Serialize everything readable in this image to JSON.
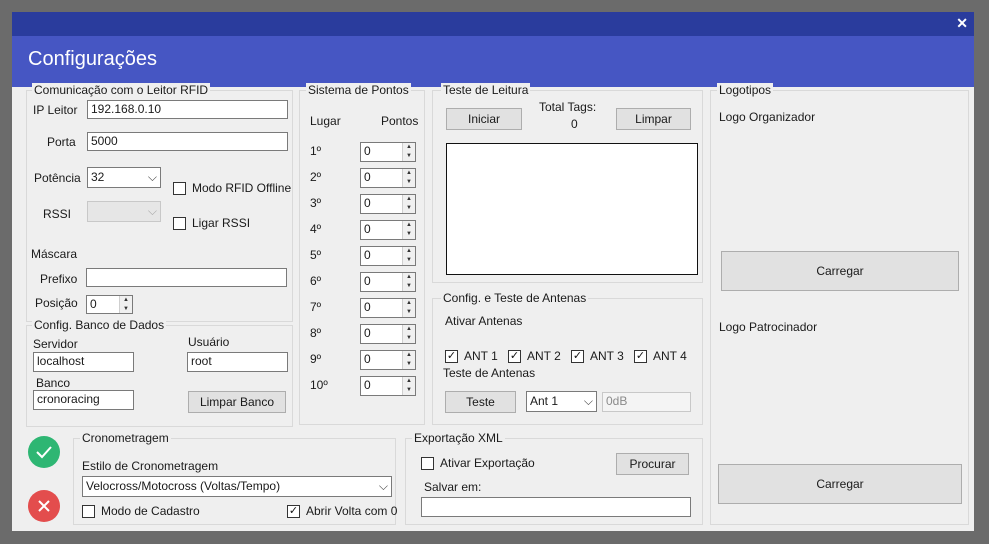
{
  "window": {
    "title": "Configurações",
    "close_glyph": "✕"
  },
  "rfid": {
    "group": "Comunicação com o Leitor RFID",
    "ip_label": "IP Leitor",
    "ip_value": "192.168.0.10",
    "port_label": "Porta",
    "port_value": "5000",
    "power_label": "Potência",
    "power_value": "32",
    "offline_label": "Modo RFID Offline",
    "offline_checked": false,
    "rssi_label": "RSSI",
    "rssi_value": "",
    "rssi_toggle_label": "Ligar RSSI",
    "rssi_toggle_checked": false,
    "mask_label": "Máscara",
    "prefix_label": "Prefixo",
    "prefix_value": "",
    "position_label": "Posição",
    "position_value": "0"
  },
  "db": {
    "group": "Config. Banco de Dados",
    "server_label": "Servidor",
    "server_value": "localhost",
    "user_label": "Usuário",
    "user_value": "root",
    "bank_label": "Banco",
    "bank_value": "cronoracing",
    "clear_button": "Limpar Banco"
  },
  "points": {
    "group": "Sistema de Pontos",
    "place_header": "Lugar",
    "points_header": "Pontos",
    "rows": [
      {
        "place": "1º",
        "value": "0"
      },
      {
        "place": "2º",
        "value": "0"
      },
      {
        "place": "3º",
        "value": "0"
      },
      {
        "place": "4º",
        "value": "0"
      },
      {
        "place": "5º",
        "value": "0"
      },
      {
        "place": "6º",
        "value": "0"
      },
      {
        "place": "7º",
        "value": "0"
      },
      {
        "place": "8º",
        "value": "0"
      },
      {
        "place": "9º",
        "value": "0"
      },
      {
        "place": "10º",
        "value": "0"
      }
    ]
  },
  "read_test": {
    "group": "Teste de Leitura",
    "start_button": "Iniciar",
    "total_label": "Total Tags:",
    "total_value": "0",
    "clear_button": "Limpar"
  },
  "antennas": {
    "group": "Config. e Teste de Antenas",
    "enable_label": "Ativar Antenas",
    "items": [
      {
        "label": "ANT 1",
        "checked": true
      },
      {
        "label": "ANT 2",
        "checked": true
      },
      {
        "label": "ANT 3",
        "checked": true
      },
      {
        "label": "ANT 4",
        "checked": true
      }
    ],
    "test_label": "Teste de Antenas",
    "test_button": "Teste",
    "ant_select": "Ant 1",
    "db_value": "0dB"
  },
  "logos": {
    "group": "Logotipos",
    "organizer_label": "Logo Organizador",
    "organizer_button": "Carregar",
    "sponsor_label": "Logo Patrocinador",
    "sponsor_button": "Carregar"
  },
  "timing": {
    "group": "Cronometragem",
    "style_label": "Estilo de Cronometragem",
    "style_value": "Velocross/Motocross (Voltas/Tempo)",
    "register_label": "Modo de Cadastro",
    "register_checked": false,
    "open_lap_label": "Abrir Volta com 0",
    "open_lap_checked": true
  },
  "export": {
    "group": "Exportação XML",
    "enable_label": "Ativar Exportação",
    "enable_checked": false,
    "browse_button": "Procurar",
    "save_label": "Salvar em:",
    "save_value": ""
  },
  "actions": {
    "confirm_color": "#2eb673",
    "cancel_color": "#e34d4d"
  }
}
